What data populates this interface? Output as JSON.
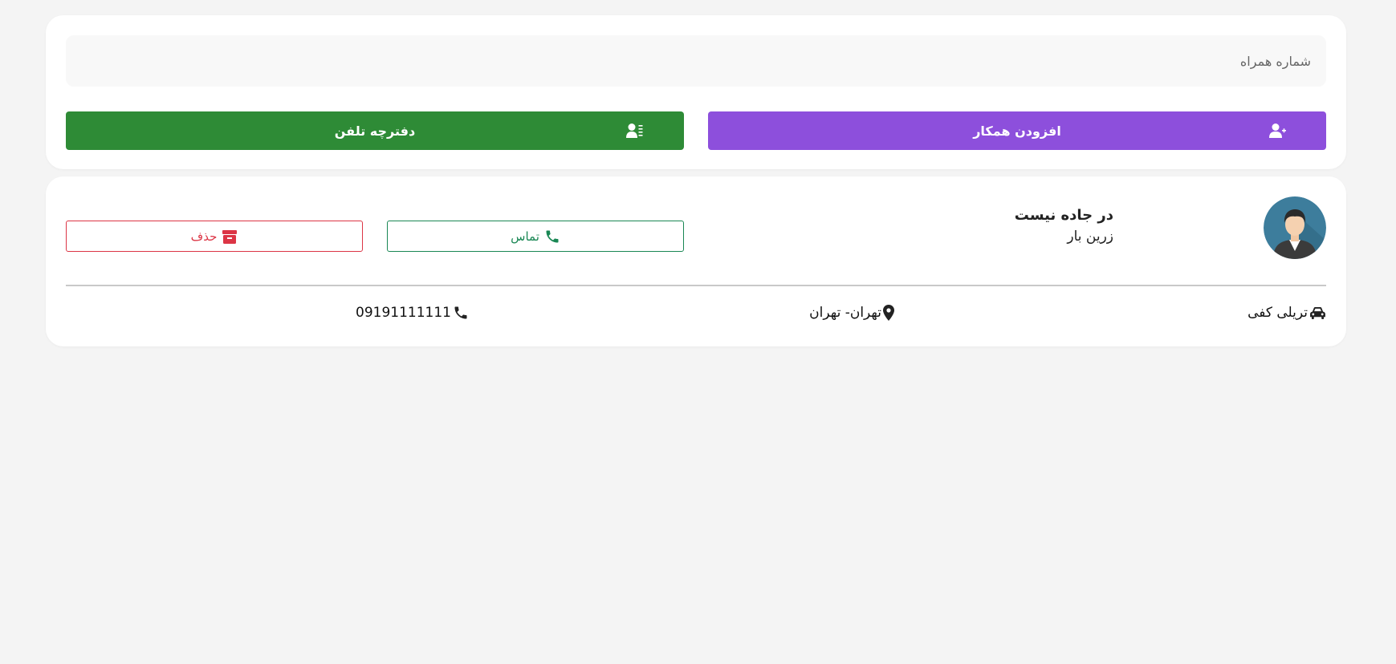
{
  "search": {
    "placeholder": "شماره همراه"
  },
  "buttons": {
    "add_colleague": "افزودن همکار",
    "phonebook": "دفترچه تلفن"
  },
  "contact": {
    "status": "در جاده نیست",
    "company": "زرین بار",
    "call_label": "تماس",
    "delete_label": "حذف",
    "vehicle": "تریلی کفی",
    "location": "تهران- تهران",
    "phone": "09191111111"
  },
  "icons": {
    "add_user": "user-plus-icon",
    "phonebook": "address-book-icon",
    "call": "phone-icon",
    "delete": "archive-icon",
    "vehicle": "car-icon",
    "location": "map-marker-icon",
    "phone": "phone-icon"
  },
  "colors": {
    "purple": "#8d4fdc",
    "green": "#2e8b36",
    "call_green": "#198754",
    "delete_red": "#dc3545"
  }
}
